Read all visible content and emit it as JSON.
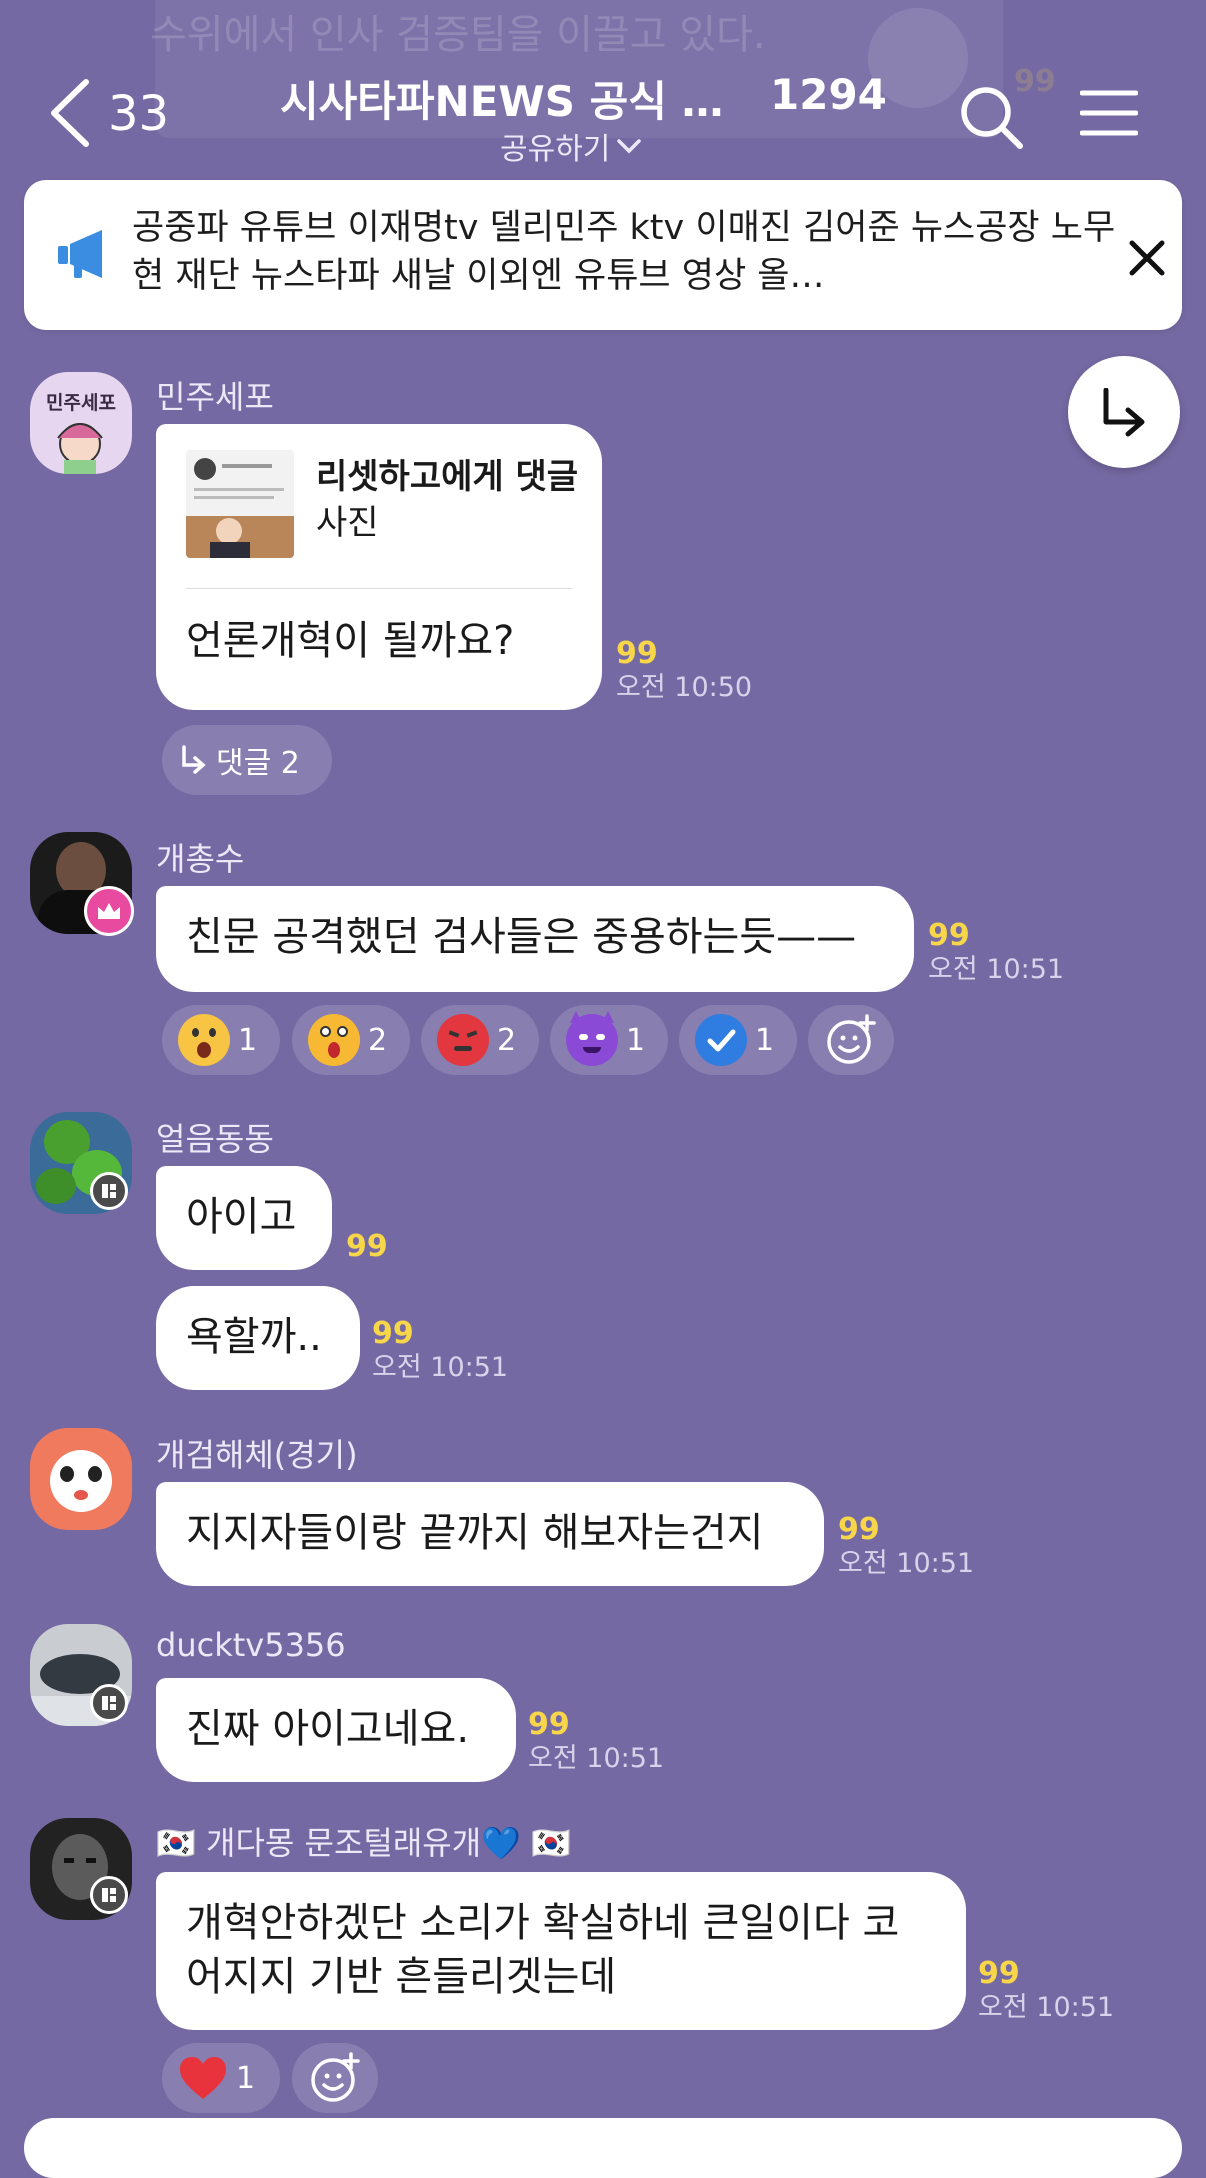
{
  "header": {
    "ghost_text": "수위에서 인사 검증팀을 이끌고 있다.",
    "back_count": "33",
    "title": "시사타파NEWS 공식 단…",
    "member_count": "1294",
    "share_label": "공유하기"
  },
  "notice": {
    "text": "공중파 유튜브 이재명tv 델리민주 ktv 이매진 김어준 뉴스공장 노무현 재단 뉴스타파 새날 이외엔 유튜브 영상 올…"
  },
  "messages": [
    {
      "sender": "민주세포",
      "avatar_text": "민주세포",
      "link_title": "리셋하고에게 댓글",
      "link_sub": "사진",
      "text": "언론개혁이 될까요?",
      "count": "99",
      "time": "오전 10:50",
      "reply_label": "댓글 2"
    },
    {
      "sender": "개총수",
      "text": "친문 공격했던 검사들은 중용하는듯——",
      "count": "99",
      "time": "오전 10:51",
      "reactions": [
        {
          "icon": "surprised-face-icon",
          "count": "1"
        },
        {
          "icon": "astonished-face-icon",
          "count": "2"
        },
        {
          "icon": "angry-face-icon",
          "count": "2"
        },
        {
          "icon": "devil-face-icon",
          "count": "1"
        },
        {
          "icon": "check-icon",
          "count": "1"
        }
      ]
    },
    {
      "sender": "얼음동동",
      "text": "아이고",
      "count": "99",
      "text2": "욕할까..",
      "count2": "99",
      "time2": "오전 10:51"
    },
    {
      "sender": "개검해체(경기)",
      "text": "지지자들이랑 끝까지 해보자는건지",
      "count": "99",
      "time": "오전 10:51"
    },
    {
      "sender": "ducktv5356",
      "text": "진짜 아이고네요.",
      "count": "99",
      "time": "오전 10:51"
    },
    {
      "sender": "🇰🇷 개다몽 문조털래유개💙 🇰🇷",
      "text": "개혁안하겠단 소리가 확실하네 큰일이다 코어지지 기반 흔들리겟는데",
      "count": "99",
      "time": "오전 10:51",
      "reactions": [
        {
          "icon": "heart-icon",
          "count": "1"
        }
      ]
    }
  ],
  "colors": {
    "background": "#7569a3",
    "bubble": "#ffffff",
    "read_count": "#f7d64a",
    "notice_icon": "#3a8de0",
    "crown_badge": "#e84aa0"
  }
}
